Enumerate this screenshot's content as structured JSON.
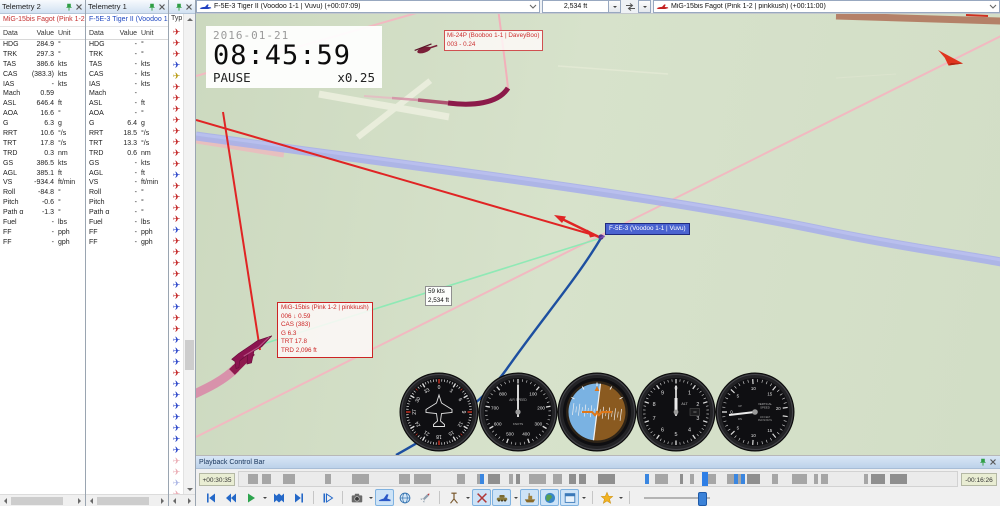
{
  "colors": {
    "friendly_blue": "#2048c0",
    "enemy_red": "#c43030",
    "trail_pink": "#f2b9c1",
    "trail_red": "#e02424",
    "trail_blue_band": "#a9b0e9",
    "trail_blue_dark": "#1d4fa0",
    "link_green": "#8fe9b5",
    "trail_magenta": "#8e1a4e",
    "timeline_blue": "#2f7fe6"
  },
  "panels": {
    "telemetry2": {
      "title": "Telemetry 2",
      "subtitle": "MiG-15bis Fagot (Pink 1-2 |...",
      "columns": [
        "Data",
        "Value",
        "Unit"
      ],
      "rows": [
        [
          "HDG",
          "284.9",
          "°"
        ],
        [
          "TRK",
          "297.3",
          "°"
        ],
        [
          "TAS",
          "386.6",
          "kts"
        ],
        [
          "CAS",
          "(383.3)",
          "kts"
        ],
        [
          "IAS",
          "-",
          "kts"
        ],
        [
          "Mach",
          "0.59",
          ""
        ],
        [
          "ASL",
          "646.4",
          "ft"
        ],
        [
          "AOA",
          "16.6",
          "°"
        ],
        [
          "G",
          "6.3",
          "g"
        ],
        [
          "RRT",
          "10.6",
          "°/s"
        ],
        [
          "TRT",
          "17.8",
          "°/s"
        ],
        [
          "TRD",
          "0.3",
          "nm"
        ],
        [
          "GS",
          "386.5",
          "kts"
        ],
        [
          "AGL",
          "385.1",
          "ft"
        ],
        [
          "VS",
          "-934.4",
          "ft/min"
        ],
        [
          "Roll",
          "-84.8",
          "°"
        ],
        [
          "Pitch",
          "-0.6",
          "°"
        ],
        [
          "Path α",
          "-1.3",
          "°"
        ],
        [
          "Fuel",
          "-",
          "lbs"
        ],
        [
          "FF",
          "-",
          "pph"
        ],
        [
          "FF",
          "-",
          "gph"
        ]
      ]
    },
    "telemetry1": {
      "title": "Telemetry 1",
      "subtitle": "F-5E-3 Tiger II (Voodoo 1-1 ...",
      "columns": [
        "Data",
        "Value",
        "Unit"
      ],
      "rows": [
        [
          "HDG",
          "-",
          "°"
        ],
        [
          "TRK",
          "-",
          "°"
        ],
        [
          "TAS",
          "-",
          "kts"
        ],
        [
          "CAS",
          "-",
          "kts"
        ],
        [
          "IAS",
          "-",
          "kts"
        ],
        [
          "Mach",
          "-",
          ""
        ],
        [
          "ASL",
          "-",
          "ft"
        ],
        [
          "AOA",
          "-",
          "°"
        ],
        [
          "G",
          "6.4",
          "g"
        ],
        [
          "RRT",
          "18.5",
          "°/s"
        ],
        [
          "TRT",
          "13.3",
          "°/s"
        ],
        [
          "TRD",
          "0.6",
          "nm"
        ],
        [
          "GS",
          "-",
          "kts"
        ],
        [
          "AGL",
          "-",
          "ft"
        ],
        [
          "VS",
          "-",
          "ft/min"
        ],
        [
          "Roll",
          "-",
          "°"
        ],
        [
          "Pitch",
          "-",
          "°"
        ],
        [
          "Path α",
          "-",
          "°"
        ],
        [
          "Fuel",
          "-",
          "lbs"
        ],
        [
          "FF",
          "-",
          "pph"
        ],
        [
          "FF",
          "-",
          "gph"
        ]
      ]
    },
    "objects": {
      "column": "Typ",
      "items": [
        "r",
        "r",
        "r",
        "b",
        "y",
        "r",
        "r",
        "r",
        "r",
        "r",
        "r",
        "r",
        "r",
        "b",
        "r",
        "r",
        "r",
        "r",
        "b",
        "r",
        "r",
        "r",
        "r",
        "b",
        "r",
        "b",
        "r",
        "r",
        "b",
        "b",
        "b",
        "r",
        "b",
        "b",
        "b",
        "b",
        "b",
        "b",
        "b",
        "pr",
        "pr",
        "pb",
        "pr"
      ]
    }
  },
  "topbar": {
    "left_object": "F-5E-3 Tiger II (Voodoo 1-1 | Vuvu) (+00:07:09)",
    "range": "2,534 ft",
    "right_object": "MiG-15bis Fagot (Pink 1-2 | pinkkush) (+00:11:00)"
  },
  "map": {
    "clock": {
      "date": "2016-01-21",
      "time": "08:45:59",
      "state": "PAUSE",
      "speed": "x0.25"
    },
    "labels": {
      "mi24": [
        "Mi-24P (Booboo 1-1 | DaveyBoo)",
        "003 - 0.24"
      ],
      "f5": "F-5E-3 (Voodoo 1-1 | Vuvu)",
      "mig": [
        "MiG-15bis (Pink 1-2 | pinkkush)",
        "006 ↓ 0.59",
        "CAS (383)",
        "G 6.3",
        "TRT 17.8",
        "TRD 2,096 ft"
      ],
      "range": [
        "59 kts",
        "2,534 ft"
      ]
    }
  },
  "gauges": {
    "heading": {
      "labels": [
        "0",
        "3",
        "6",
        "9",
        "12",
        "15",
        "18",
        "21",
        "24",
        "27",
        "30",
        "33"
      ]
    },
    "airspeed": {
      "title": "AIR SPEED",
      "subtitle": "KNOTS",
      "labels": [
        "100",
        "200",
        "300",
        "400",
        "500",
        "600",
        "700",
        "800"
      ]
    },
    "attitude": {},
    "altimeter": {
      "title": "ALT",
      "labels": [
        "0",
        "1",
        "2",
        "3",
        "4",
        "5",
        "6",
        "7",
        "8",
        "9"
      ],
      "window": "30"
    },
    "vsi": {
      "title1": "VERTICAL",
      "title2": "SPEED",
      "sub1": "100 FEET",
      "sub2": "PER MINUTE",
      "up": "UP",
      "dn": "DN",
      "zero": "0",
      "labels_up": [
        "5",
        "10",
        "15",
        "20"
      ],
      "labels_dn": [
        "5",
        "10",
        "15"
      ]
    }
  },
  "playback": {
    "title": "Playback Control Bar",
    "time_left": "+00:30:35",
    "time_right": "-00:16:26",
    "timeline": {
      "seed": 7,
      "cursor_pct": 64.5,
      "blue_pct": [
        33.6,
        56.5,
        68.9,
        69.9
      ]
    },
    "transport": [
      {
        "name": "skip-start"
      },
      {
        "name": "rewind"
      },
      {
        "name": "play",
        "dropdown": true
      },
      {
        "name": "fast-forward"
      },
      {
        "name": "skip-end"
      },
      {
        "sep": true
      },
      {
        "name": "step"
      },
      {
        "sep": true
      }
    ],
    "tools": [
      {
        "name": "camera",
        "dropdown": true
      },
      {
        "name": "aircraft",
        "selected": true
      },
      {
        "name": "globe"
      },
      {
        "name": "missile"
      },
      {
        "sep": true
      },
      {
        "name": "tripod",
        "dropdown": true
      },
      {
        "name": "cross",
        "selected": true
      },
      {
        "name": "vehicle",
        "selected": true,
        "dropdown": true
      },
      {
        "name": "ship",
        "selected": true
      },
      {
        "name": "earth",
        "selected": true
      },
      {
        "name": "window",
        "selected": true,
        "dropdown": true
      },
      {
        "sep": true
      },
      {
        "name": "star",
        "dropdown": true
      },
      {
        "sep": true
      }
    ]
  }
}
